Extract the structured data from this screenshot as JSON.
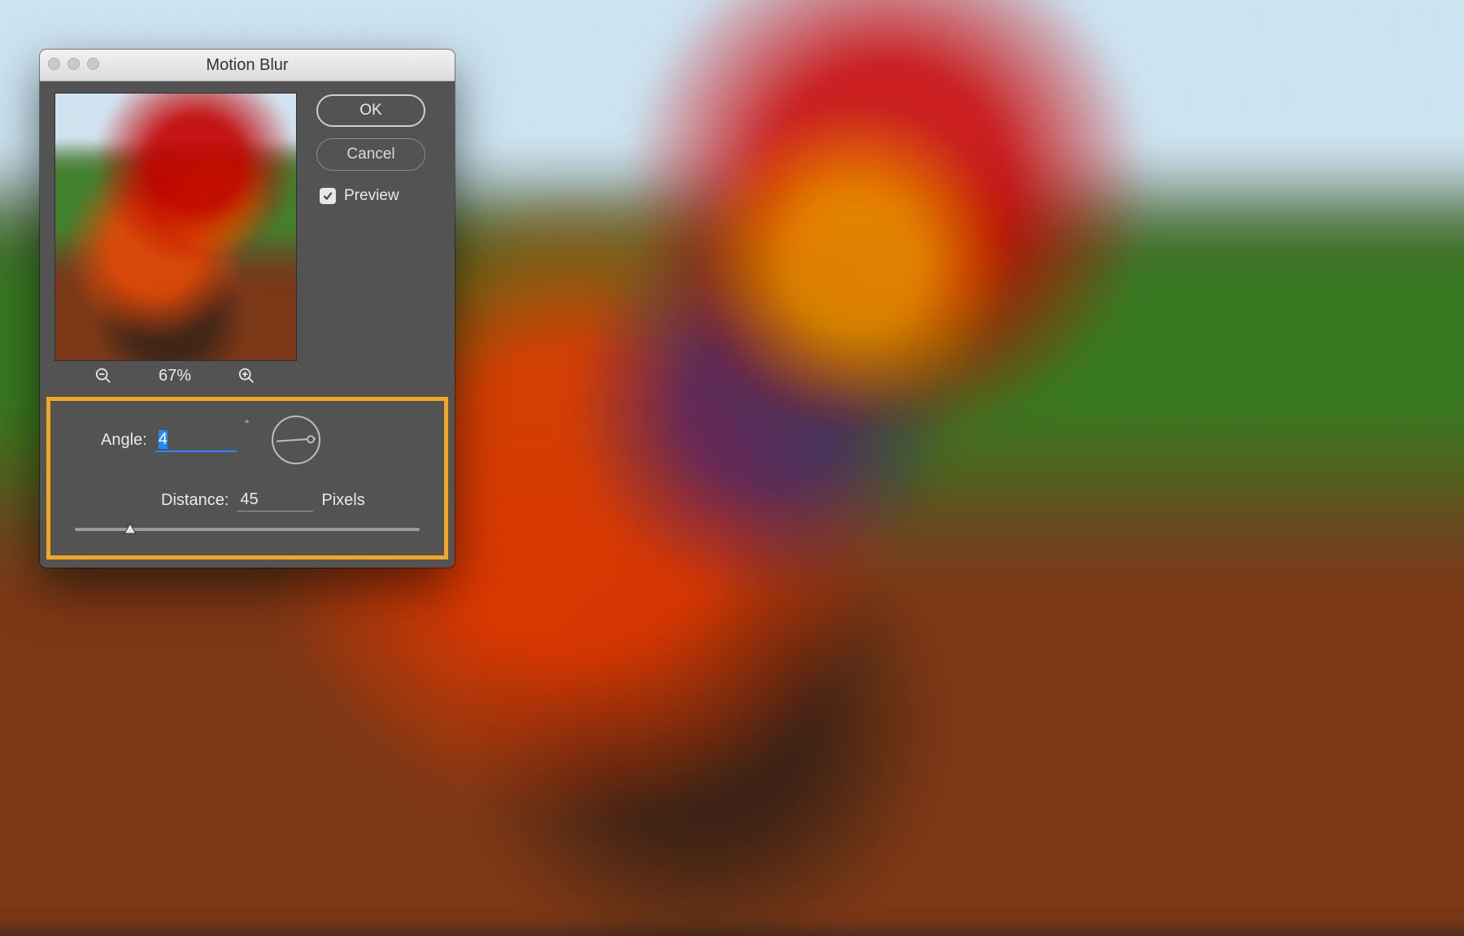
{
  "dialog": {
    "title": "Motion Blur",
    "ok_label": "OK",
    "cancel_label": "Cancel",
    "preview_label": "Preview",
    "preview_checked": true,
    "zoom_pct": "67%"
  },
  "params": {
    "angle_label": "Angle:",
    "angle_value": "4",
    "distance_label": "Distance:",
    "distance_value": "45",
    "distance_unit": "Pixels"
  },
  "colors": {
    "panel": "#535353",
    "highlight_border": "#f5a623",
    "focus_underline": "#1f8bff"
  }
}
